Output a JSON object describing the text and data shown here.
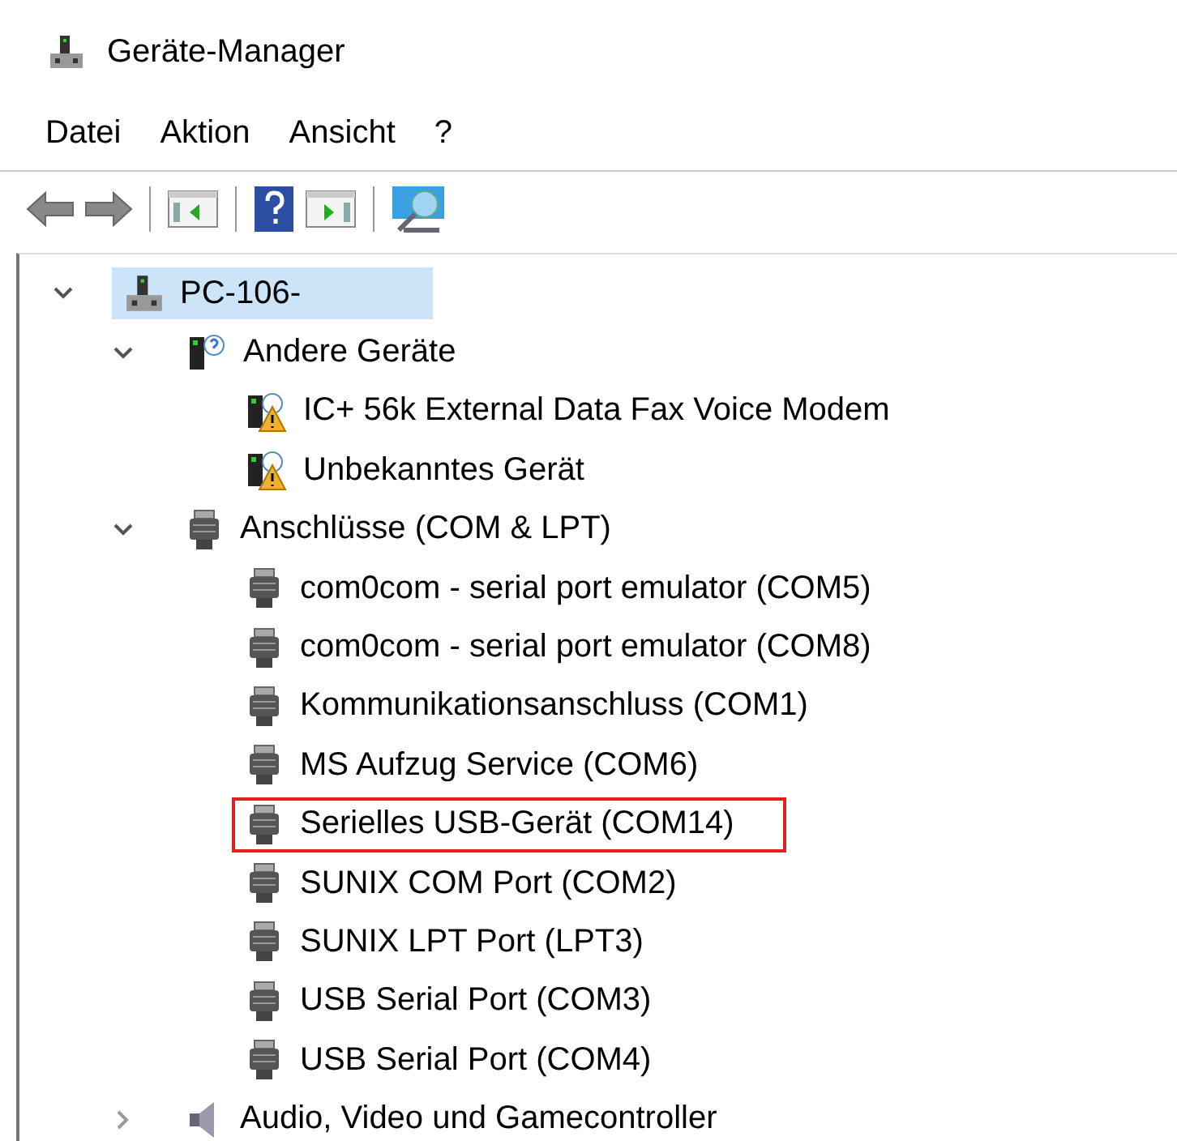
{
  "window": {
    "title": "Geräte-Manager"
  },
  "menu": [
    "Datei",
    "Aktion",
    "Ansicht",
    "?"
  ],
  "tree": [
    {
      "label": "PC-106-",
      "kind": "computer",
      "expanded": true,
      "selected": true,
      "marked": false,
      "children": [
        {
          "label": "Andere Geräte",
          "kind": "unknown",
          "expanded": true,
          "selected": false,
          "marked": false,
          "children": [
            {
              "label": "IC+ 56k External Data Fax Voice Modem",
              "kind": "warning",
              "selected": false,
              "marked": false
            },
            {
              "label": "Unbekanntes Gerät",
              "kind": "warning",
              "selected": false,
              "marked": false
            }
          ]
        },
        {
          "label": "Anschlüsse (COM & LPT)",
          "kind": "port",
          "expanded": true,
          "selected": false,
          "marked": false,
          "children": [
            {
              "label": "com0com - serial port emulator (COM5)",
              "kind": "port",
              "selected": false,
              "marked": false
            },
            {
              "label": "com0com - serial port emulator (COM8)",
              "kind": "port",
              "selected": false,
              "marked": false
            },
            {
              "label": "Kommunikationsanschluss (COM1)",
              "kind": "port",
              "selected": false,
              "marked": false
            },
            {
              "label": "MS Aufzug Service (COM6)",
              "kind": "port",
              "selected": false,
              "marked": false
            },
            {
              "label": "Serielles USB-Gerät (COM14)",
              "kind": "port",
              "selected": false,
              "marked": true
            },
            {
              "label": "SUNIX COM Port (COM2)",
              "kind": "port",
              "selected": false,
              "marked": false
            },
            {
              "label": "SUNIX LPT Port (LPT3)",
              "kind": "port",
              "selected": false,
              "marked": false
            },
            {
              "label": "USB Serial Port (COM3)",
              "kind": "port",
              "selected": false,
              "marked": false
            },
            {
              "label": "USB Serial Port (COM4)",
              "kind": "port",
              "selected": false,
              "marked": false
            }
          ]
        },
        {
          "label": "Audio, Video und Gamecontroller",
          "kind": "audio",
          "expanded": false,
          "selected": false,
          "marked": false
        }
      ]
    }
  ]
}
